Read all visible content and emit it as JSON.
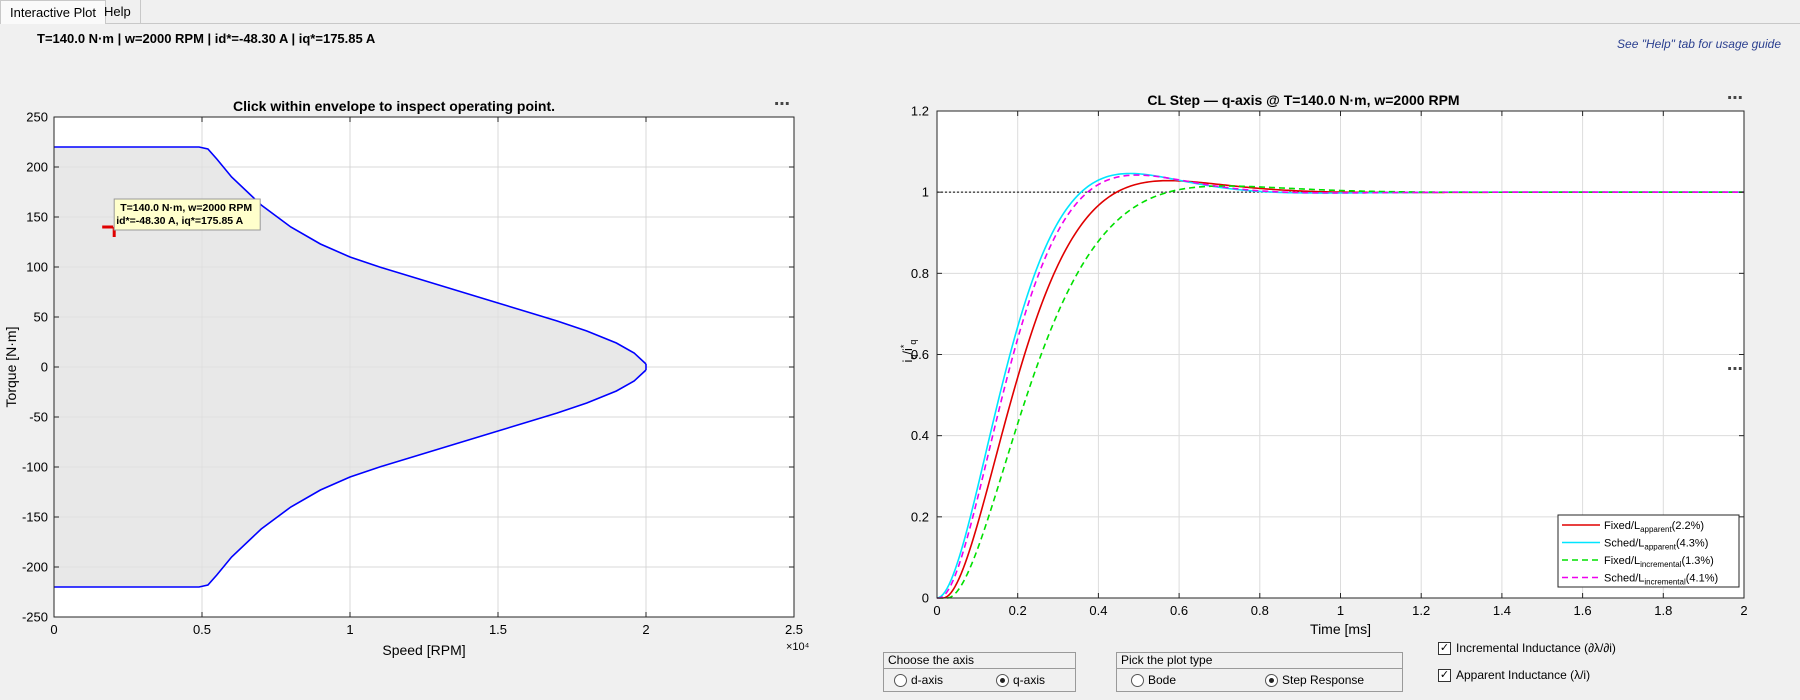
{
  "tabs": [
    {
      "label": "Interactive Plot",
      "active": true
    },
    {
      "label": "Help",
      "active": false
    }
  ],
  "status": {
    "text": "T=140.0 N·m  |  w=2000 RPM  |  id*=-48.30 A  |  iq*=175.85 A",
    "help_hint": "See \"Help\" tab for usage guide"
  },
  "menu_dots": "⋯",
  "envelope_plot": {
    "title": "Click within envelope to inspect operating point.",
    "xlabel": "Speed [RPM]",
    "ylabel": "Torque [N·m]",
    "x_multiplier": "×10⁴",
    "chart_data": {
      "type": "area",
      "x_scale": 10000,
      "xlim": [
        0,
        25000
      ],
      "ylim": [
        -250,
        250
      ],
      "x_ticks": [
        0,
        5000,
        10000,
        15000,
        20000,
        25000
      ],
      "x_tick_labels": [
        "0",
        "0.5",
        "1",
        "1.5",
        "2",
        "2.5"
      ],
      "y_ticks": [
        -250,
        -200,
        -150,
        -100,
        -50,
        0,
        50,
        100,
        150,
        200,
        250
      ],
      "grid": true,
      "upper": {
        "x": [
          0,
          4900,
          5200,
          5500,
          6000,
          7000,
          8000,
          9000,
          10000,
          11000,
          12000,
          13000,
          14000,
          15000,
          16000,
          17000,
          18000,
          19000,
          19600,
          20000
        ],
        "y": [
          220,
          220,
          218,
          208,
          190,
          162,
          140,
          123,
          110,
          100,
          91,
          82,
          73,
          64,
          55,
          46,
          36,
          24,
          14,
          3
        ]
      },
      "lower": {
        "x": [
          0,
          4900,
          5200,
          5500,
          6000,
          7000,
          8000,
          9000,
          10000,
          11000,
          12000,
          13000,
          14000,
          15000,
          16000,
          17000,
          18000,
          19000,
          19600,
          20000
        ],
        "y": [
          -220,
          -220,
          -218,
          -208,
          -190,
          -162,
          -140,
          -123,
          -110,
          -100,
          -91,
          -82,
          -73,
          -64,
          -55,
          -46,
          -36,
          -24,
          -14,
          -3
        ]
      },
      "line_color": "#0000ff",
      "fill_color": "#e8e8e8",
      "marker": {
        "x": 2000,
        "y": 140,
        "color": "#e00000"
      },
      "annotation_lines": [
        "T=140.0 N·m, w=2000 RPM",
        "id*=-48.30 A, iq*=175.85 A"
      ]
    }
  },
  "step_plot": {
    "title": "CL Step — q-axis @ T=140.0 N·m, w=2000 RPM",
    "xlabel": "Time [ms]",
    "ylabel_main": "i",
    "ylabel_sub": "q",
    "ylabel_mid": "/i",
    "ylabel_sup": "*",
    "ylabel_sub2": "q",
    "chart_data": {
      "type": "line",
      "xlim": [
        0,
        2
      ],
      "ylim": [
        0,
        1.2
      ],
      "x_ticks": [
        0,
        0.2,
        0.4,
        0.6,
        0.8,
        1,
        1.2,
        1.4,
        1.6,
        1.8,
        2
      ],
      "y_ticks": [
        0,
        0.2,
        0.4,
        0.6,
        0.8,
        1,
        1.2
      ],
      "grid": true,
      "reference_y": 1,
      "legend_position": "bottom-right",
      "series": [
        {
          "name": "Fixed/L",
          "sub": "apparent",
          "pct": "(2.2%)",
          "color": "#e00000",
          "dash": "",
          "wn": 8.5,
          "zeta": 0.75,
          "delay": 0.015
        },
        {
          "name": "Sched/L",
          "sub": "apparent",
          "pct": "(4.3%)",
          "color": "#00e5ff",
          "dash": "",
          "wn": 9.2,
          "zeta": 0.7,
          "delay": 0.0
        },
        {
          "name": "Fixed/L",
          "sub": "incremental",
          "pct": "(1.3%)",
          "color": "#00e000",
          "dash": "6,4",
          "wn": 7.6,
          "zeta": 0.8,
          "delay": 0.025
        },
        {
          "name": "Sched/L",
          "sub": "incremental",
          "pct": "(4.1%)",
          "color": "#ee00ee",
          "dash": "6,4",
          "wn": 9.1,
          "zeta": 0.71,
          "delay": 0.005
        }
      ]
    }
  },
  "axis_group": {
    "title": "Choose the axis",
    "options": [
      {
        "label": "d-axis",
        "selected": false
      },
      {
        "label": "q-axis",
        "selected": true
      }
    ]
  },
  "plot_type_group": {
    "title": "Pick the plot type",
    "options": [
      {
        "label": "Bode",
        "selected": false
      },
      {
        "label": "Step Response",
        "selected": true
      }
    ]
  },
  "checkboxes": [
    {
      "label": "Incremental Inductance (∂λ/∂i)",
      "checked": true
    },
    {
      "label": "Apparent Inductance (λ/i)",
      "checked": true
    }
  ],
  "check_mark": "✓"
}
